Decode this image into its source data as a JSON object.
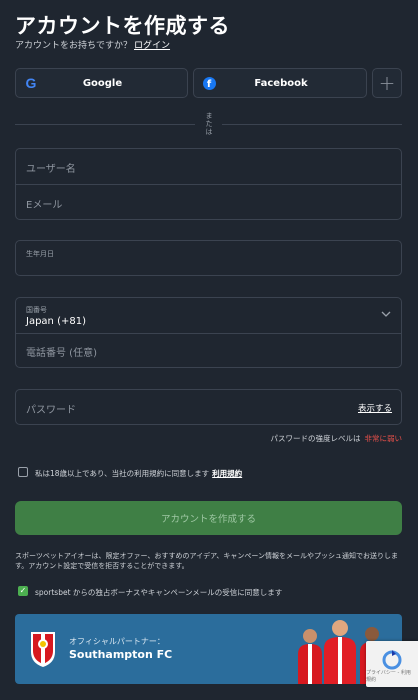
{
  "header": {
    "title": "アカウントを作成する",
    "subtitle": "アカウントをお持ちですか？",
    "login_link": "ログイン"
  },
  "social": {
    "google_label": "Google",
    "facebook_label": "Facebook",
    "more_label": "+"
  },
  "divider": {
    "text": "または"
  },
  "form": {
    "username_placeholder": "ユーザー名",
    "email_placeholder": "Eメール",
    "dob_label": "生年月日",
    "country_label": "国番号",
    "country_value": "Japan (+81)",
    "phone_placeholder": "電話番号 (任意)",
    "password_placeholder": "パスワード",
    "show_password": "表示する",
    "strength_label": "パスワードの強度レベルは",
    "strength_value": "非常に弱い"
  },
  "terms": {
    "text": "私は18歳以上であり、当社の利用規約に同意します",
    "link": "利用規約",
    "checked": false
  },
  "submit": {
    "label": "アカウントを作成する"
  },
  "disclaimer": "スポーツベットアイオーは、限定オファー、おすすめのアイデア、キャンペーン情報をメールやプッシュ通知でお送りします。アカウント設定で受信を拒否することができます。",
  "optin": {
    "text": "sportsbet からの独占ボーナスやキャンペーンメールの受信に同意します",
    "checked": true
  },
  "banner": {
    "label": "オフィシャルパートナー：",
    "club": "Southampton FC"
  },
  "recaptcha": {
    "text": "プライバシー - 利用規約"
  },
  "colors": {
    "background": "#1f2630",
    "field_border": "#3b4350",
    "submit_bg": "#3f7f45",
    "accent_green": "#4caf50",
    "weak_red": "#e8504a",
    "banner_bg": "#2b6d9c"
  }
}
